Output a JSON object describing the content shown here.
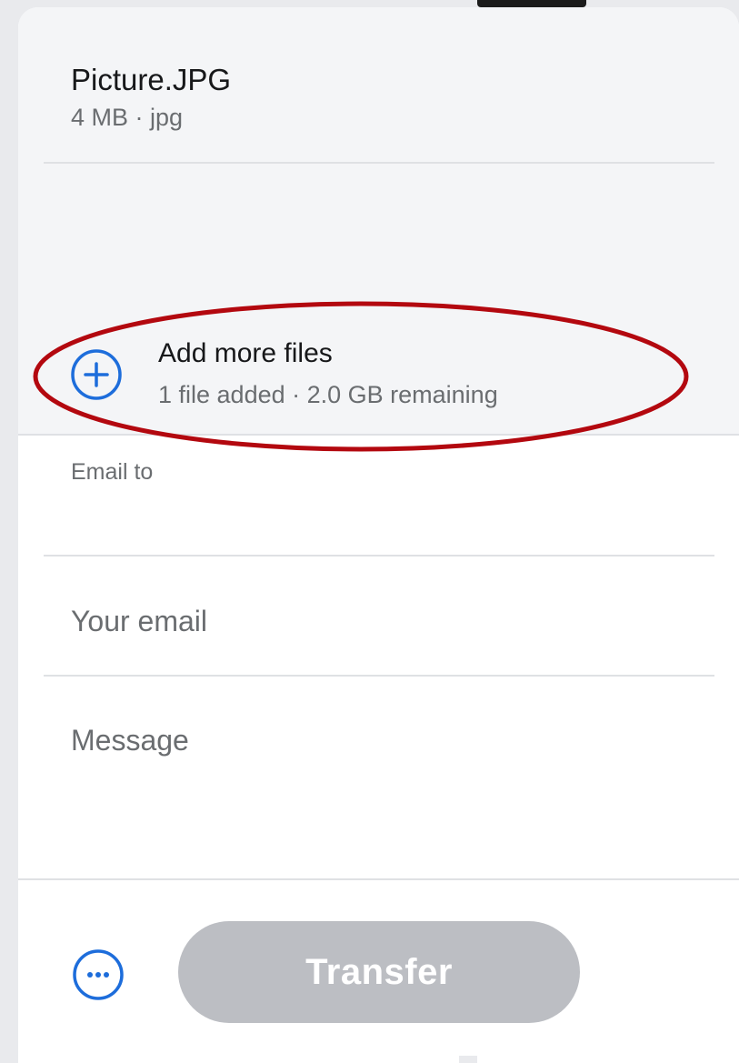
{
  "file": {
    "name": "Picture.JPG",
    "meta": "4 MB · jpg"
  },
  "add_more": {
    "label": "Add more files",
    "status": "1 file added · 2.0 GB remaining",
    "icon": "plus-circle-icon"
  },
  "form": {
    "email_to_label": "Email to",
    "email_to_value": "",
    "your_email_placeholder": "Your email",
    "message_placeholder": "Message"
  },
  "footer": {
    "more_icon": "more-options-icon",
    "transfer_label": "Transfer"
  },
  "colors": {
    "accent": "#1d6ddb",
    "highlight": "#b3080f",
    "button_disabled": "#bcbec3",
    "panel_background": "#f4f5f7"
  }
}
